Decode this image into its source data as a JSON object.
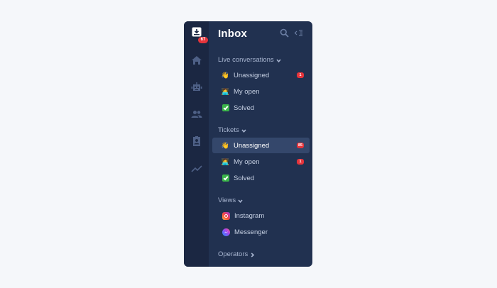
{
  "header": {
    "title": "Inbox"
  },
  "rail": {
    "inbox_badge": "67"
  },
  "sections": [
    {
      "label": "Live conversations",
      "items": [
        {
          "emoji": "👋",
          "label": "Unassigned",
          "count": "1"
        },
        {
          "emoji": "🧑‍💻",
          "label": "My open",
          "count": ""
        },
        {
          "emoji": "check",
          "label": "Solved",
          "count": ""
        }
      ]
    },
    {
      "label": "Tickets",
      "items": [
        {
          "emoji": "👋",
          "label": "Unassigned",
          "count": "85"
        },
        {
          "emoji": "🧑‍💻",
          "label": "My open",
          "count": "1"
        },
        {
          "emoji": "check",
          "label": "Solved",
          "count": ""
        }
      ]
    },
    {
      "label": "Views",
      "items": [
        {
          "emoji": "instagram",
          "label": "Instagram",
          "count": ""
        },
        {
          "emoji": "messenger",
          "label": "Messenger",
          "count": ""
        }
      ]
    },
    {
      "label": "Operators"
    }
  ],
  "colors": {
    "panel": "#213150",
    "rail": "#1b2742",
    "active": "#34476b",
    "badge": "#e5343b"
  }
}
